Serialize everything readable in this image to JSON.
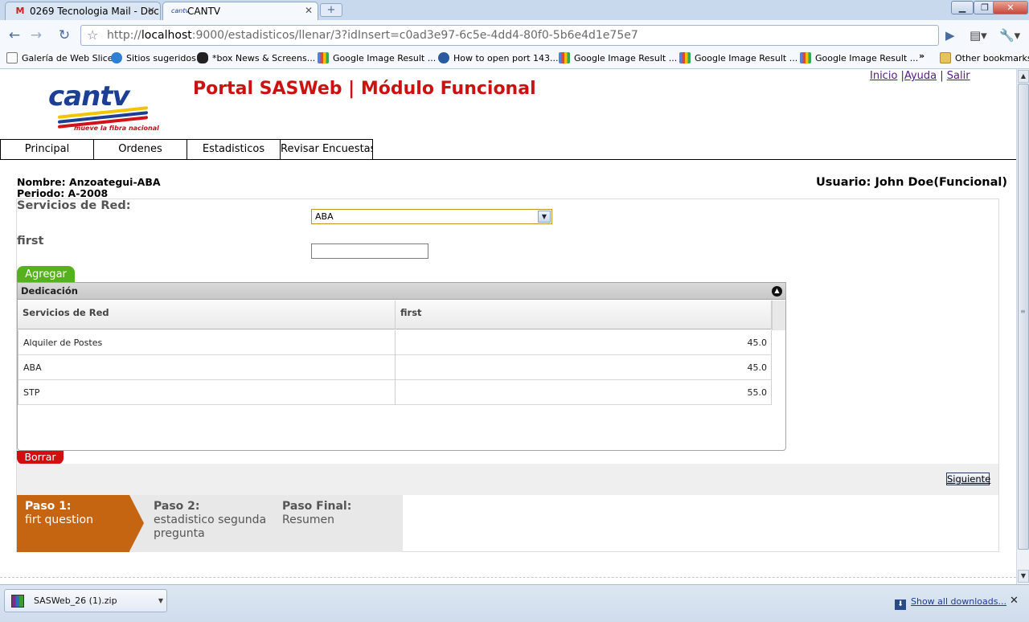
{
  "browser": {
    "tabs": [
      {
        "title": "0269 Tecnologia Mail - Doc...",
        "favicon": "gmail-icon",
        "active": false
      },
      {
        "title": "CANTV",
        "favicon": "cantv-icon",
        "active": true
      }
    ],
    "url_prefix": "http://",
    "url_host": "localhost",
    "url_rest": ":9000/estadisticos/llenar/3?idInsert=c0ad3e97-6c5e-4dd4-80f0-5b6e4d1e75e7",
    "bookmarks": [
      {
        "label": "Galería de Web Slice",
        "icon": "page-icon"
      },
      {
        "label": "Sitios sugeridos",
        "icon": "ie-icon"
      },
      {
        "label": "*box News & Screens...",
        "icon": "xbox-icon"
      },
      {
        "label": "Google Image Result ...",
        "icon": "google-icon"
      },
      {
        "label": "How to open port 143...",
        "icon": "plus-circle-icon"
      },
      {
        "label": "Google Image Result ...",
        "icon": "google-icon"
      },
      {
        "label": "Google Image Result ...",
        "icon": "google-icon"
      },
      {
        "label": "Google Image Result ...",
        "icon": "google-icon"
      }
    ],
    "other_bookmarks": "Other bookmarks",
    "chevron": "»"
  },
  "page": {
    "logo_text": "cantv",
    "logo_tagline": "mueve la fibra nacional",
    "portal_title": "Portal SASWeb | Módulo Funcional",
    "toplinks": {
      "inicio": "Inicio",
      "ayuda": "Ayuda",
      "salir": "Salir",
      "sep": "|"
    },
    "menu": [
      "Principal",
      "Ordenes",
      "Estadisticos",
      "Revisar Encuestas"
    ],
    "info": {
      "nombre": "Nombre: Anzoategui-ABA",
      "periodo": "Periodo: A-2008",
      "usuario": "Usuario: John Doe(Funcional)"
    },
    "form": {
      "servicios_label": "Servicios de Red:",
      "servicios_selected": "ABA",
      "first_label": "first",
      "first_value": ""
    },
    "buttons": {
      "agregar": "Agregar",
      "borrar": "Borrar",
      "siguiente": "Siguiente"
    },
    "grid": {
      "title": "Dedicación",
      "columns": [
        "Servicios de Red",
        "first"
      ],
      "rows": [
        [
          "Alquiler de Postes",
          "45.0"
        ],
        [
          "ABA",
          "45.0"
        ],
        [
          "STP",
          "55.0"
        ]
      ]
    },
    "wizard": [
      {
        "title": "Paso 1:",
        "text": "firt question",
        "active": true
      },
      {
        "title": "Paso 2:",
        "text": "estadistico segunda pregunta",
        "active": false
      },
      {
        "title": "Paso Final:",
        "text": "Resumen",
        "active": false
      }
    ]
  },
  "downloads": {
    "file": "SASWeb_26 (1).zip",
    "show_all": "Show all downloads..."
  },
  "colors": {
    "portal_red": "#cc1111",
    "agregar_green": "#55b21d",
    "borrar_red": "#d40e0e",
    "wizard_orange": "#c56512",
    "logo_blue": "#1c3f95"
  }
}
